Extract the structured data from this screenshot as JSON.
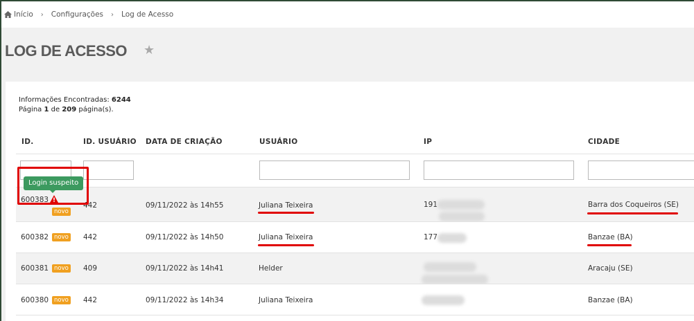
{
  "breadcrumb": {
    "home": "Início",
    "item2": "Configurações",
    "item3": "Log de Acesso"
  },
  "page": {
    "title": "LOG DE ACESSO"
  },
  "info": {
    "found_label": "Informações Encontradas:",
    "found_count": "6244",
    "page_word": "Página",
    "page_current": "1",
    "page_of": "de",
    "page_total": "209",
    "page_suffix": "página(s)."
  },
  "columns": [
    "ID.",
    "ID. USUÁRIO",
    "DATA DE CRIAÇÃO",
    "USUÁRIO",
    "IP",
    "CIDADE"
  ],
  "tooltip": "Login suspeito",
  "badge_text": "novo",
  "rows": [
    {
      "id": "600383",
      "user_id": "442",
      "date": "09/11/2022 às 14h55",
      "user": "Juliana Teixeira",
      "ip": "191",
      "city": "Barra dos Coqueiros (SE)"
    },
    {
      "id": "600382",
      "user_id": "442",
      "date": "09/11/2022 às 14h50",
      "user": "Juliana Teixeira",
      "ip": "177",
      "city": "Banzae (BA)"
    },
    {
      "id": "600381",
      "user_id": "409",
      "date": "09/11/2022 às 14h41",
      "user": "Helder",
      "ip": "",
      "city": "Aracaju (SE)"
    },
    {
      "id": "600380",
      "user_id": "442",
      "date": "09/11/2022 às 14h34",
      "user": "Juliana Teixeira",
      "ip": "",
      "city": "Banzae (BA)"
    }
  ],
  "colors": {
    "accent_red": "#e00000",
    "tooltip_green": "#3c9a5f",
    "badge_orange": "#f0a020"
  }
}
